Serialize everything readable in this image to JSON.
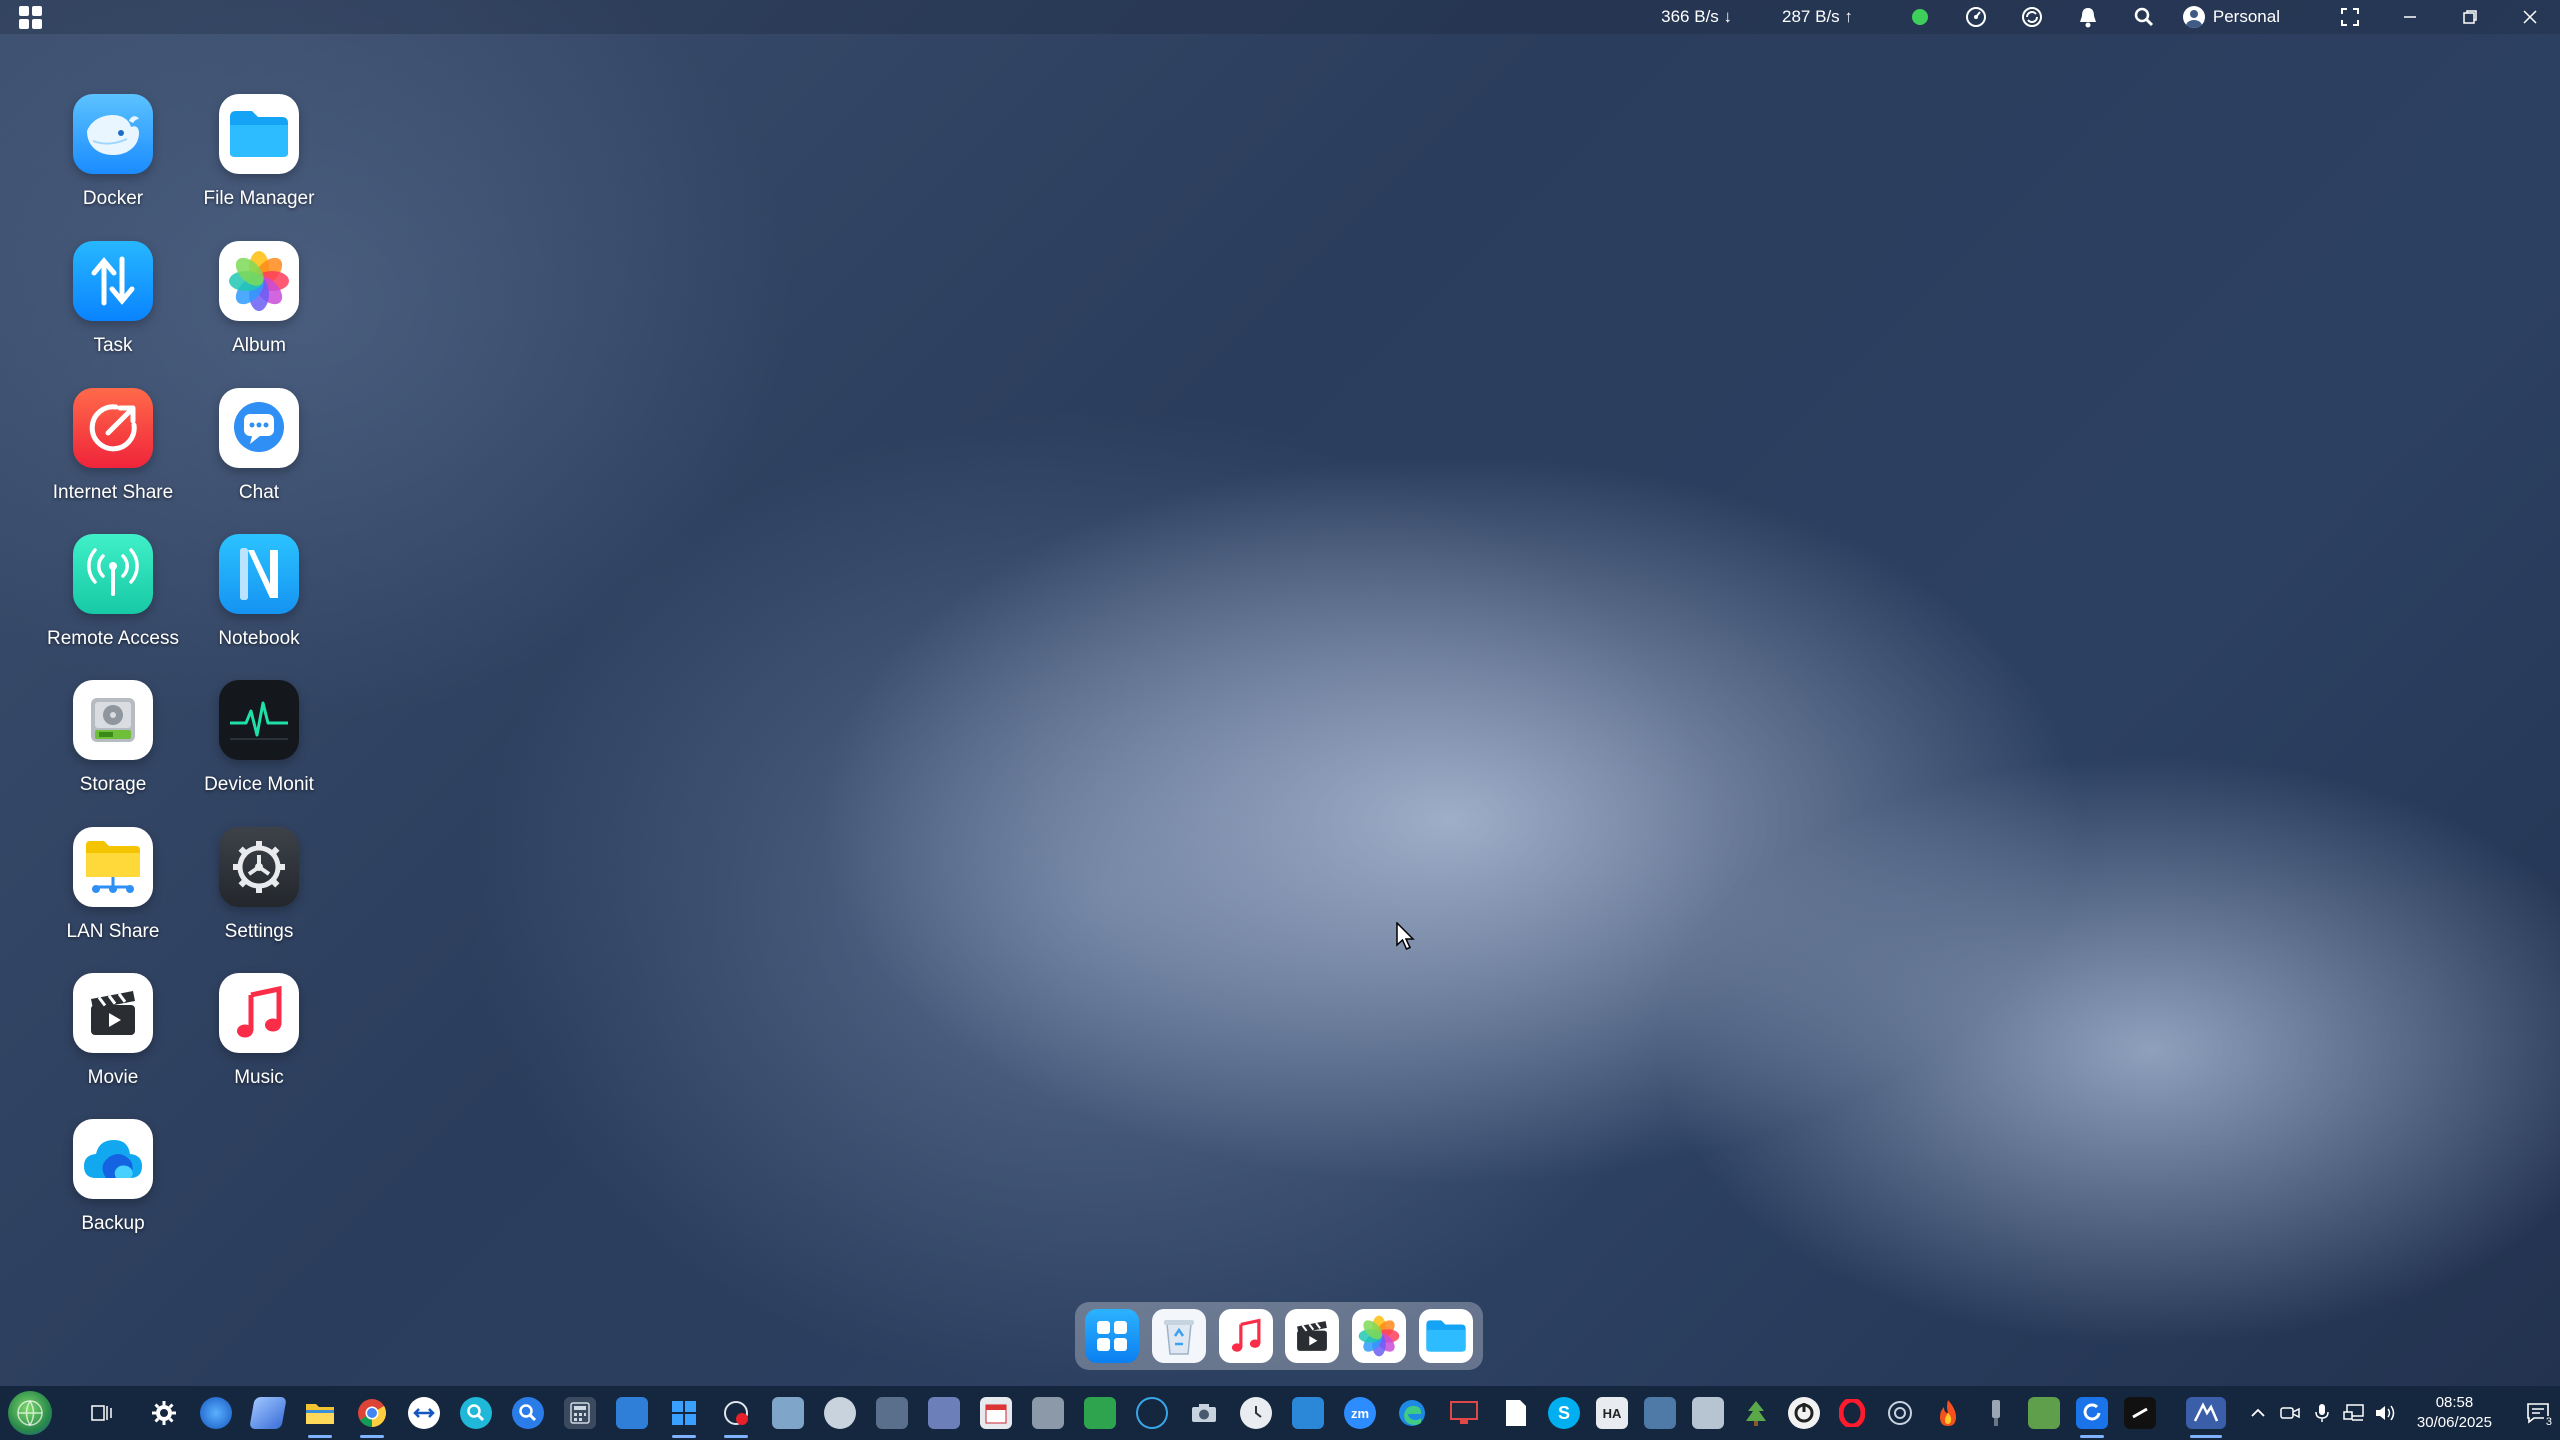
{
  "topbar": {
    "download_speed": "366 B/s ↓",
    "upload_speed": "287 B/s ↑",
    "status_color": "#3ecf5a",
    "profile_name": "Personal"
  },
  "desktop_icons": [
    {
      "label": "Docker",
      "icon": "docker-whale-icon"
    },
    {
      "label": "File Manager",
      "icon": "folder-icon"
    },
    {
      "label": "Task",
      "icon": "task-arrows-icon"
    },
    {
      "label": "Album",
      "icon": "photos-flower-icon"
    },
    {
      "label": "Internet Share",
      "icon": "internet-share-icon"
    },
    {
      "label": "Chat",
      "icon": "chat-bubble-icon"
    },
    {
      "label": "Remote Access",
      "icon": "remote-access-antenna-icon"
    },
    {
      "label": "Notebook",
      "icon": "notebook-n-icon"
    },
    {
      "label": "Storage",
      "icon": "hard-drive-icon"
    },
    {
      "label": "Device Monit",
      "icon": "heartbeat-monitor-icon"
    },
    {
      "label": "LAN Share",
      "icon": "lan-share-folder-icon"
    },
    {
      "label": "Settings",
      "icon": "gear-icon"
    },
    {
      "label": "Movie",
      "icon": "clapperboard-icon"
    },
    {
      "label": "Music",
      "icon": "music-note-icon"
    },
    {
      "label": "Backup",
      "icon": "cloud-backup-icon"
    }
  ],
  "dock": [
    "launchpad-icon",
    "recycle-bin-icon",
    "music-note-icon",
    "clapperboard-icon",
    "photos-flower-icon",
    "folder-icon"
  ],
  "taskbar": {
    "time": "08:58",
    "date": "30/06/2025",
    "notification_count": "3",
    "app_labels": [
      "zm",
      "S",
      "HA"
    ]
  },
  "colors": {
    "accent": "#1a8cff",
    "taskbar_bg": "#15263f"
  }
}
